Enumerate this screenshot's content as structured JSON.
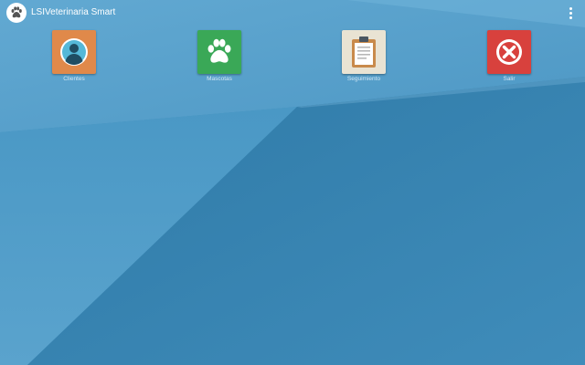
{
  "app": {
    "title": "LSIVeterinaria Smart",
    "logo_icon": "paw-icon"
  },
  "menu": {
    "overflow_icon": "more-vertical-icon"
  },
  "tiles": [
    {
      "label": "Clientes",
      "icon": "user-profile-icon",
      "color": "#e0894a"
    },
    {
      "label": "Mascotas",
      "icon": "paw-icon",
      "color": "#3aa857"
    },
    {
      "label": "Seguimiento",
      "icon": "clipboard-icon",
      "color": "#e9e3d3"
    },
    {
      "label": "Salir",
      "icon": "close-circle-icon",
      "color": "#d8413d"
    }
  ],
  "colors": {
    "background": "#3f8fbb",
    "text": "#ffffff"
  }
}
